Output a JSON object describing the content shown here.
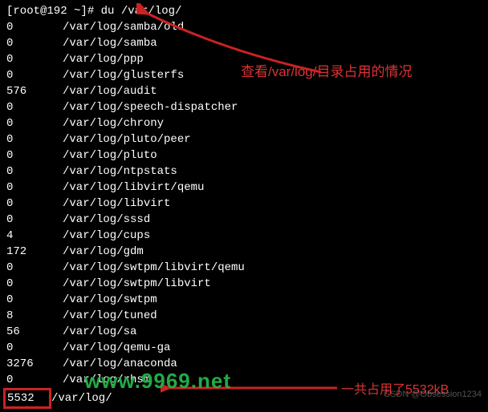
{
  "prompt": "[root@192 ~]# ",
  "command": "du /var/log/",
  "rows": [
    {
      "size": "0",
      "path": "/var/log/samba/old"
    },
    {
      "size": "0",
      "path": "/var/log/samba"
    },
    {
      "size": "0",
      "path": "/var/log/ppp"
    },
    {
      "size": "0",
      "path": "/var/log/glusterfs"
    },
    {
      "size": "576",
      "path": "/var/log/audit"
    },
    {
      "size": "0",
      "path": "/var/log/speech-dispatcher"
    },
    {
      "size": "0",
      "path": "/var/log/chrony"
    },
    {
      "size": "0",
      "path": "/var/log/pluto/peer"
    },
    {
      "size": "0",
      "path": "/var/log/pluto"
    },
    {
      "size": "0",
      "path": "/var/log/ntpstats"
    },
    {
      "size": "0",
      "path": "/var/log/libvirt/qemu"
    },
    {
      "size": "0",
      "path": "/var/log/libvirt"
    },
    {
      "size": "0",
      "path": "/var/log/sssd"
    },
    {
      "size": "4",
      "path": "/var/log/cups"
    },
    {
      "size": "172",
      "path": "/var/log/gdm"
    },
    {
      "size": "0",
      "path": "/var/log/swtpm/libvirt/qemu"
    },
    {
      "size": "0",
      "path": "/var/log/swtpm/libvirt"
    },
    {
      "size": "0",
      "path": "/var/log/swtpm"
    },
    {
      "size": "8",
      "path": "/var/log/tuned"
    },
    {
      "size": "56",
      "path": "/var/log/sa"
    },
    {
      "size": "0",
      "path": "/var/log/qemu-ga"
    },
    {
      "size": "3276",
      "path": "/var/log/anaconda"
    },
    {
      "size": "0",
      "path": "/var/log/rhsm"
    }
  ],
  "last_row": {
    "size": "5532",
    "path": "/var/log/"
  },
  "annotations": {
    "a1": "查看/var/log/目录占用的情况",
    "a2": "一共占用了5532kB"
  },
  "watermark": {
    "url": "www.9969.net",
    "csdn": "CSDN @Obsession1234"
  },
  "arrows": {
    "color": "#cc2222"
  }
}
